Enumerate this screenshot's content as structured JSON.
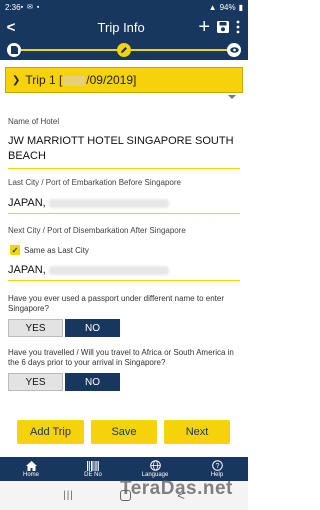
{
  "status_bar": {
    "time": "2:36",
    "battery": "94%"
  },
  "header": {
    "title": "Trip Info"
  },
  "trip": {
    "prefix": "Trip 1 [",
    "suffix": "/09/2019]"
  },
  "hotel": {
    "label": "Name of Hotel",
    "value": "JW MARRIOTT HOTEL SINGAPORE SOUTH BEACH"
  },
  "embarkation": {
    "label": "Last City / Port of Embarkation Before Singapore",
    "value": "JAPAN,"
  },
  "disembarkation": {
    "label": "Next City / Port of Disembarkation After Singapore",
    "same_as_label": "Same as Last City",
    "same_as_checked": true,
    "value": "JAPAN,"
  },
  "question1": {
    "text": "Have you ever used a passport under different name to enter Singapore?",
    "yes": "YES",
    "no": "NO",
    "selected": "NO"
  },
  "question2": {
    "text": "Have you travelled / Will you travel to Africa or South America in the 6 days prior to your arrival in Singapore?",
    "yes": "YES",
    "no": "NO",
    "selected": "NO"
  },
  "actions": {
    "add_trip": "Add Trip",
    "save": "Save",
    "next": "Next"
  },
  "bottom_nav": [
    {
      "label": "Home",
      "icon": "home-icon"
    },
    {
      "label": "DE No",
      "icon": "barcode-icon"
    },
    {
      "label": "Language",
      "icon": "globe-icon"
    },
    {
      "label": "Help",
      "icon": "help-icon"
    }
  ],
  "watermark": "TeraDas.net",
  "colors": {
    "primary": "#17375e",
    "accent": "#f5d20a"
  }
}
